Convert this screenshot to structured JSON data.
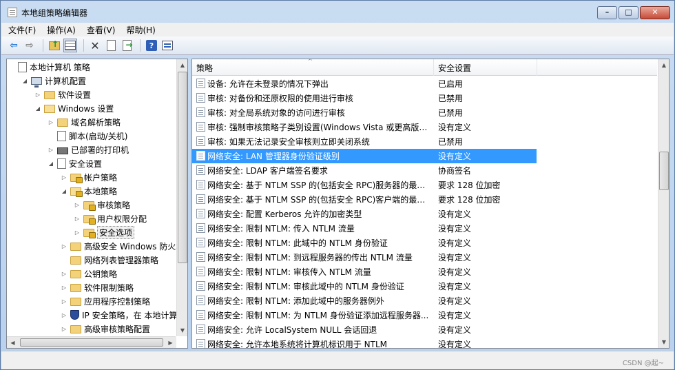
{
  "window": {
    "title": "本地组策略编辑器",
    "min_glyph": "–",
    "max_glyph": "□",
    "close_glyph": "✕"
  },
  "menu": [
    "文件(F)",
    "操作(A)",
    "查看(V)",
    "帮助(H)"
  ],
  "toolbar": {
    "icons": [
      "back-icon",
      "forward-icon",
      "up-folder-icon",
      "show-hide-tree-icon",
      "delete-icon",
      "properties-sheet-icon",
      "export-list-icon",
      "help-icon",
      "properties-icon"
    ]
  },
  "tree": {
    "items": [
      {
        "label": "本地计算机 策略",
        "twisty": "",
        "icon": "policy",
        "indent": 0
      },
      {
        "label": "计算机配置",
        "twisty": "◢",
        "icon": "computer",
        "indent": 1
      },
      {
        "label": "软件设置",
        "twisty": "▷",
        "icon": "folder",
        "indent": 2
      },
      {
        "label": "Windows 设置",
        "twisty": "◢",
        "icon": "folder-open",
        "indent": 2
      },
      {
        "label": "域名解析策略",
        "twisty": "▷",
        "icon": "folder",
        "indent": 3
      },
      {
        "label": "脚本(启动/关机)",
        "twisty": "",
        "icon": "script",
        "indent": 3
      },
      {
        "label": "已部署的打印机",
        "twisty": "▷",
        "icon": "printer",
        "indent": 3
      },
      {
        "label": "安全设置",
        "twisty": "◢",
        "icon": "policy",
        "indent": 3
      },
      {
        "label": "帐户策略",
        "twisty": "▷",
        "icon": "folder-lock",
        "indent": 4
      },
      {
        "label": "本地策略",
        "twisty": "◢",
        "icon": "folder-lock-open",
        "indent": 4
      },
      {
        "label": "审核策略",
        "twisty": "▷",
        "icon": "folder-lock",
        "indent": 5
      },
      {
        "label": "用户权限分配",
        "twisty": "▷",
        "icon": "folder-lock",
        "indent": 5
      },
      {
        "label": "安全选项",
        "twisty": "▷",
        "icon": "folder-lock",
        "indent": 5,
        "selected": true
      },
      {
        "label": "高级安全 Windows 防火墙",
        "twisty": "▷",
        "icon": "folder",
        "indent": 4
      },
      {
        "label": "网络列表管理器策略",
        "twisty": "",
        "icon": "folder",
        "indent": 4
      },
      {
        "label": "公钥策略",
        "twisty": "▷",
        "icon": "folder",
        "indent": 4
      },
      {
        "label": "软件限制策略",
        "twisty": "▷",
        "icon": "folder",
        "indent": 4
      },
      {
        "label": "应用程序控制策略",
        "twisty": "▷",
        "icon": "folder",
        "indent": 4
      },
      {
        "label": "IP 安全策略，在 本地计算机",
        "twisty": "▷",
        "icon": "shield",
        "indent": 4
      },
      {
        "label": "高级审核策略配置",
        "twisty": "▷",
        "icon": "folder",
        "indent": 4
      }
    ]
  },
  "list": {
    "columns": [
      "策略",
      "安全设置"
    ],
    "rows": [
      {
        "policy": "设备: 允许在未登录的情况下弹出",
        "setting": "已启用"
      },
      {
        "policy": "审核: 对备份和还原权限的使用进行审核",
        "setting": "已禁用"
      },
      {
        "policy": "审核: 对全局系统对象的访问进行审核",
        "setting": "已禁用"
      },
      {
        "policy": "审核: 强制审核策略子类别设置(Windows Vista 或更高版本...",
        "setting": "没有定义"
      },
      {
        "policy": "审核: 如果无法记录安全审核则立即关闭系统",
        "setting": "已禁用"
      },
      {
        "policy": "网络安全: LAN 管理器身份验证级别",
        "setting": "没有定义",
        "selected": true
      },
      {
        "policy": "网络安全: LDAP 客户端签名要求",
        "setting": "协商签名"
      },
      {
        "policy": "网络安全: 基于 NTLM SSP 的(包括安全 RPC)服务器的最小...",
        "setting": "要求 128 位加密"
      },
      {
        "policy": "网络安全: 基于 NTLM SSP 的(包括安全 RPC)客户端的最小...",
        "setting": "要求 128 位加密"
      },
      {
        "policy": "网络安全: 配置 Kerberos 允许的加密类型",
        "setting": "没有定义"
      },
      {
        "policy": "网络安全: 限制 NTLM: 传入 NTLM 流量",
        "setting": "没有定义"
      },
      {
        "policy": "网络安全: 限制 NTLM: 此域中的 NTLM 身份验证",
        "setting": "没有定义"
      },
      {
        "policy": "网络安全: 限制 NTLM: 到远程服务器的传出 NTLM 流量",
        "setting": "没有定义"
      },
      {
        "policy": "网络安全: 限制 NTLM: 审核传入 NTLM 流量",
        "setting": "没有定义"
      },
      {
        "policy": "网络安全: 限制 NTLM: 审核此域中的 NTLM 身份验证",
        "setting": "没有定义"
      },
      {
        "policy": "网络安全: 限制 NTLM: 添加此域中的服务器例外",
        "setting": "没有定义"
      },
      {
        "policy": "网络安全: 限制 NTLM: 为 NTLM 身份验证添加远程服务器...",
        "setting": "没有定义"
      },
      {
        "policy": "网络安全: 允许 LocalSystem NULL 会话回退",
        "setting": "没有定义"
      },
      {
        "policy": "网络安全: 允许本地系统将计算机标识用于 NTLM",
        "setting": "没有定义"
      }
    ]
  },
  "watermark": "CSDN @起~"
}
